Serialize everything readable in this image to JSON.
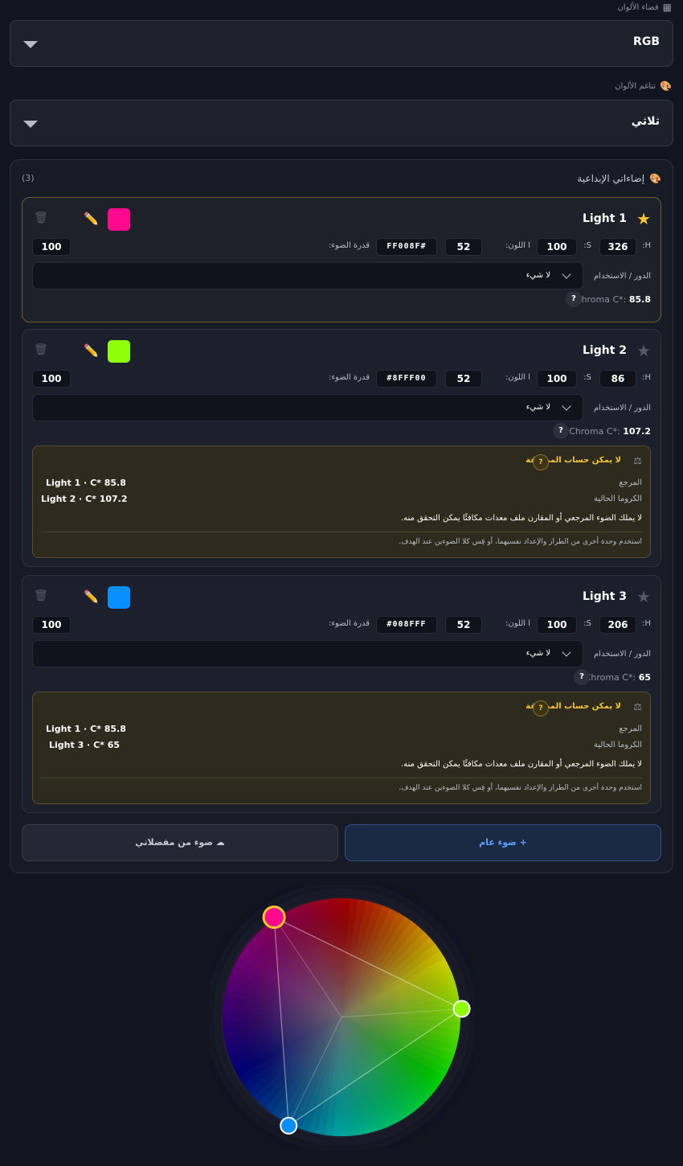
{
  "colorspace": {
    "label": "فضاء الألوان",
    "value": "RGB"
  },
  "harmony": {
    "label": "تناغم الألوان",
    "value": "ثلاثي"
  },
  "panel": {
    "title": "إضاءاتي الإبداعية",
    "count": "(3)"
  },
  "common": {
    "h_label": "H:",
    "s_label": "S:",
    "l_label": "ا اللون:",
    "intensity_label": "قدرة الضوء:",
    "role_label": "الدور / الاستخدام",
    "role_value": "لا شيء",
    "chroma_prefix": "Chroma C*:",
    "help": "?"
  },
  "lights": [
    {
      "name": "Light 1",
      "h": "326",
      "s": "100",
      "l": "52",
      "hex": "FF008F#",
      "intensity": "100",
      "chroma": "85.8",
      "color": "#ff0a8f",
      "starred": true
    },
    {
      "name": "Light 2",
      "h": "86",
      "s": "100",
      "l": "52",
      "hex": "#8FFF00",
      "intensity": "100",
      "chroma": "107.2",
      "color": "#8fff0a",
      "starred": false
    },
    {
      "name": "Light 3",
      "h": "206",
      "s": "100",
      "l": "52",
      "hex": "#008FFF",
      "intensity": "100",
      "chroma": "65",
      "color": "#0a8fff",
      "starred": false
    }
  ],
  "warnings": [
    {
      "title": "لا يمكن حساب المطابقة",
      "ref_label": "المرجع",
      "cur_label": "الكروما الحالية",
      "ref_value": "Light 1 · C* 85.8",
      "cur_value": "Light 2 · C* 107.2",
      "body": "لا يملك الضوء المرجعي أو المقارن ملف معدات مكافئًا يمكن التحقق منه.",
      "hint": "استخدم وحدة أخرى من الطراز والإعداد نفسيهما، أو قِس كلا الضوءين عند الهدف."
    },
    {
      "title": "لا يمكن حساب المطابقة",
      "ref_label": "المرجع",
      "cur_label": "الكروما الحالية",
      "ref_value": "Light 1 · C* 85.8",
      "cur_value": "Light 3 · C* 65",
      "body": "لا يملك الضوء المرجعي أو المقارن ملف معدات مكافئًا يمكن التحقق منه.",
      "hint": "استخدم وحدة أخرى من الطراز والإعداد نفسيهما، أو قِس كلا الضوءين عند الهدف."
    }
  ],
  "buttons": {
    "add_general": "+ ضوء عام",
    "from_favorites": "ضوء من مفضلاتي"
  },
  "icons": {
    "colorspace": "grid-icon",
    "harmony": "palette-icon",
    "panel": "palette-icon",
    "star": "star-icon",
    "pencil": "pencil-icon",
    "trash": "trash-icon",
    "scale": "balance-scale-icon",
    "cloud": "cloud-icon",
    "chevron": "chevron-down-icon"
  },
  "colors": {
    "warning_accent": "#f6c631",
    "primary_accent": "#5aa2ff"
  },
  "wheel": {
    "handles": [
      {
        "hue": 326
      },
      {
        "hue": 86
      },
      {
        "hue": 206
      }
    ]
  }
}
